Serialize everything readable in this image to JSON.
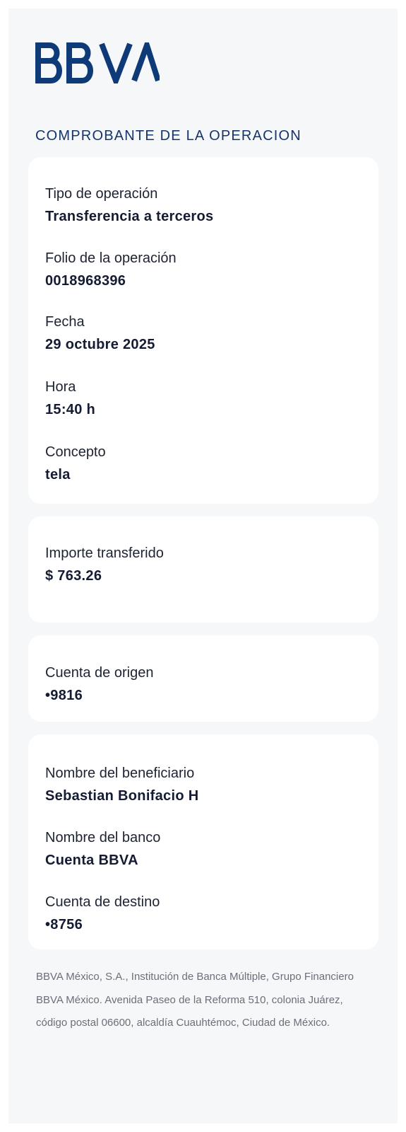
{
  "brand": {
    "logo_text": "BBVA",
    "color": "#0f3a78"
  },
  "heading": "COMPROBANTE DE LA OPERACION",
  "operation_card": {
    "fields": [
      {
        "label": "Tipo de operación",
        "value": "Transferencia a terceros"
      },
      {
        "label": "Folio de la operación",
        "value": "0018968396"
      },
      {
        "label": "Fecha",
        "value": "29 octubre 2025"
      },
      {
        "label": "Hora",
        "value": "15:40 h"
      },
      {
        "label": "Concepto",
        "value": "tela"
      }
    ]
  },
  "amount_card": {
    "fields": [
      {
        "label": "Importe transferido",
        "value": "$ 763.26"
      }
    ]
  },
  "origin_card": {
    "fields": [
      {
        "label": "Cuenta de origen",
        "value": "•9816"
      }
    ]
  },
  "beneficiary_card": {
    "fields": [
      {
        "label": "Nombre del beneficiario",
        "value": "Sebastian Bonifacio H"
      },
      {
        "label": "Nombre del banco",
        "value": "Cuenta BBVA"
      },
      {
        "label": "Cuenta de destino",
        "value": "•8756"
      }
    ]
  },
  "footer": {
    "lines": [
      "BBVA México, S.A., Institución de Banca Múltiple, Grupo Financiero",
      "BBVA México. Avenida Paseo de la Reforma 510, colonia Juárez,",
      "código postal 06600, alcaldía Cuauhtémoc, Ciudad de México."
    ]
  }
}
